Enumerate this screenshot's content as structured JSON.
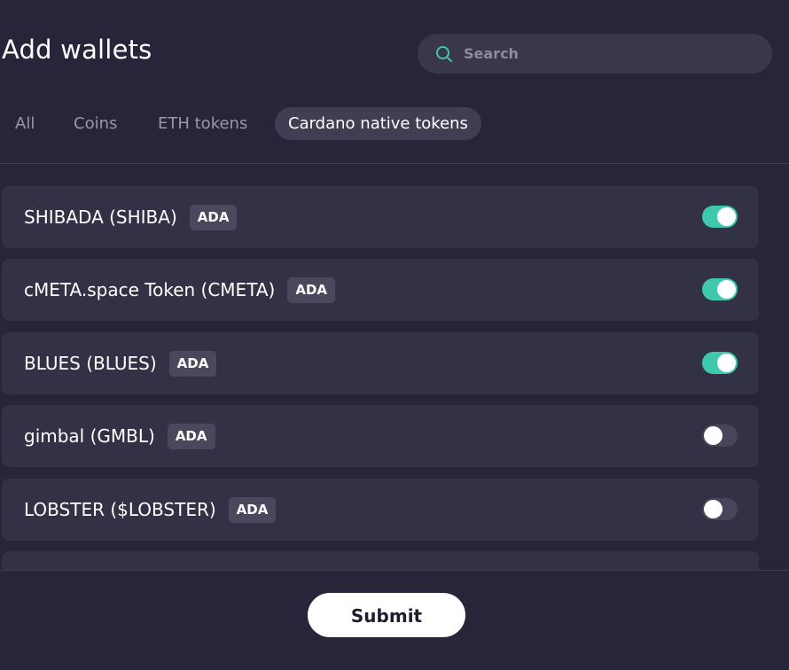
{
  "header": {
    "title": "Add wallets"
  },
  "search": {
    "placeholder": "Search",
    "value": "",
    "icon": "search-icon"
  },
  "tabs": [
    {
      "label": "All",
      "active": false
    },
    {
      "label": "Coins",
      "active": false
    },
    {
      "label": "ETH tokens",
      "active": false
    },
    {
      "label": "Cardano native tokens",
      "active": true
    }
  ],
  "tokens": [
    {
      "name": "SHIBADA (SHIBA)",
      "chain": "ADA",
      "enabled": true
    },
    {
      "name": "cMETA.space Token (CMETA)",
      "chain": "ADA",
      "enabled": true
    },
    {
      "name": "BLUES (BLUES)",
      "chain": "ADA",
      "enabled": true
    },
    {
      "name": "gimbal (GMBL)",
      "chain": "ADA",
      "enabled": false
    },
    {
      "name": "LOBSTER ($LOBSTER)",
      "chain": "ADA",
      "enabled": false
    }
  ],
  "footer": {
    "submit_label": "Submit"
  },
  "colors": {
    "background": "#272539",
    "row_background": "#333146",
    "toggle_on": "#3fc8ad",
    "toggle_off": "#47455a",
    "search_icon": "#3fc8ad",
    "badge_background": "#4a485c"
  }
}
